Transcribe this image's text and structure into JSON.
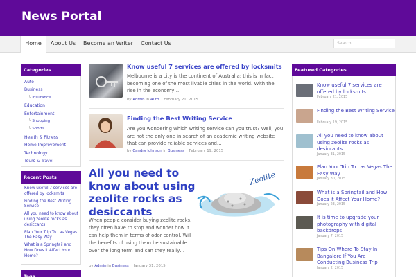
{
  "site": {
    "title": "News Portal"
  },
  "nav": {
    "items": [
      "Home",
      "About Us",
      "Become an Writer",
      "Contact Us"
    ],
    "search_placeholder": "Search ..."
  },
  "categories": {
    "title": "Categories",
    "items": [
      {
        "label": "Auto",
        "sub": false
      },
      {
        "label": "Business",
        "sub": false
      },
      {
        "label": "Insurance",
        "sub": true
      },
      {
        "label": "Education",
        "sub": false
      },
      {
        "label": "Entertainment",
        "sub": false
      },
      {
        "label": "Shopping",
        "sub": true
      },
      {
        "label": "Sports",
        "sub": true
      },
      {
        "label": "Health & Fitness",
        "sub": false
      },
      {
        "label": "Home Improvement",
        "sub": false
      },
      {
        "label": "Technology",
        "sub": false
      },
      {
        "label": "Tours & Travel",
        "sub": false
      }
    ]
  },
  "recent": {
    "title": "Recent Posts",
    "items": [
      "Know useful 7 services are offered by locksmits",
      "Finding the Best Writing Service",
      "All you need to know about using zeolite rocks as desiccants",
      "Plan Your Trip To Las Vegas The Easy Way",
      "What is a Springtail and How Does it Affect Your Home?"
    ]
  },
  "tags": {
    "title": "Tags"
  },
  "posts": [
    {
      "title": "Know useful 7 services are offered by locksmits",
      "excerpt": "Melbourne is a city is the continent of Australia; this is in fact becoming one of the most livable cities in the world. With the rise in the economy…",
      "by": "by",
      "author": "Admin",
      "in": "in",
      "category": "Auto",
      "date": "February 21, 2015"
    },
    {
      "title": "Finding the Best Writing Service",
      "excerpt": "Are you wondering which writing service can you trust? Well, you are not the only one in search of an academic writing website that can provide reliable services and…",
      "by": "by",
      "author": "Candry Johnson",
      "in": "in",
      "category": "Business",
      "date": "February 19, 2015"
    }
  ],
  "featured_post": {
    "title": "All you need to know about using zeolite rocks as desiccants",
    "excerpt": "When people consider buying zeolite rocks, they often have to stop and wonder how it can help them in terms of odor control. Will the benefits of using them be sustainable over the long term and can they really…",
    "by": "by",
    "author": "Admin",
    "in": "in",
    "category": "Business",
    "date": "January 31, 2015",
    "image_text": "Zeolite"
  },
  "featured": {
    "title": "Featured Categories",
    "items": [
      {
        "title": "Know useful 7 services are offered by locksmits",
        "date": "February 21, 2015",
        "color": "#6b6f78"
      },
      {
        "title": "Finding the Best Writing Service",
        "date": "February 19, 2015",
        "color": "#c9a58e"
      },
      {
        "title": "All you need to know about using zeolite rocks as desiccants",
        "date": "January 31, 2015",
        "color": "#9fc0cf"
      },
      {
        "title": "Plan Your Trip To Las Vegas The Easy Way",
        "date": "January 30, 2015",
        "color": "#c87a3c"
      },
      {
        "title": "What is a Springtail and How Does it Affect Your Home?",
        "date": "January 23, 2015",
        "color": "#8a4b3a"
      },
      {
        "title": "It is time to upgrade your photography with digital backdrops",
        "date": "January 7, 2015",
        "color": "#5c5a52"
      },
      {
        "title": "Tips On Where To Stay In Bangalore If You Are Conducting Business Trip",
        "date": "January 2, 2015",
        "color": "#b78a5c"
      }
    ]
  },
  "colors": {
    "brand": "#5f0a99",
    "link": "#3a44c8"
  }
}
